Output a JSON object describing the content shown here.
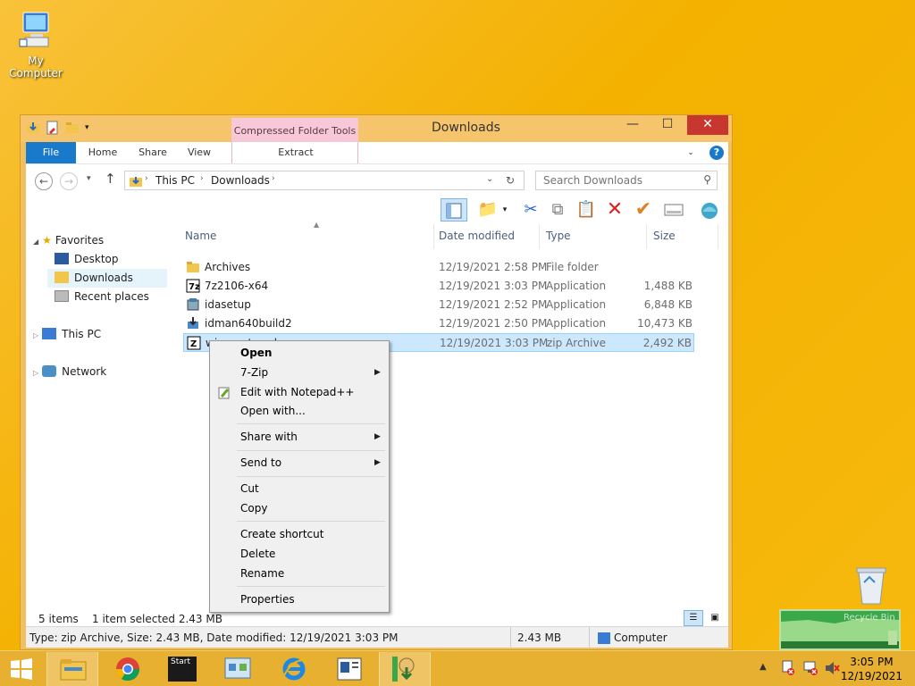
{
  "desktop": {
    "icons": [
      {
        "label": "My Computer"
      }
    ]
  },
  "window": {
    "title": "Downloads",
    "contextual_tab_group": "Compressed Folder Tools",
    "controls": {
      "minimize": "—",
      "maximize": "☐",
      "close": "✕"
    }
  },
  "ribbon": {
    "tabs": [
      "File",
      "Home",
      "Share",
      "View",
      "Extract"
    ],
    "help": "?"
  },
  "address": {
    "path": [
      "This PC",
      "Downloads"
    ],
    "search_placeholder": "Search Downloads"
  },
  "nav_pane": {
    "favorites": "Favorites",
    "desktop": "Desktop",
    "downloads": "Downloads",
    "recent": "Recent places",
    "this_pc": "This PC",
    "network": "Network"
  },
  "columns": {
    "name": "Name",
    "date": "Date modified",
    "type": "Type",
    "size": "Size"
  },
  "files": [
    {
      "name": "Archives",
      "date": "12/19/2021 2:58 PM",
      "type": "File folder",
      "size": ""
    },
    {
      "name": "7z2106-x64",
      "date": "12/19/2021 3:03 PM",
      "type": "Application",
      "size": "1,488 KB"
    },
    {
      "name": "idasetup",
      "date": "12/19/2021 2:52 PM",
      "type": "Application",
      "size": "6,848 KB"
    },
    {
      "name": "idman640build2",
      "date": "12/19/2021 2:50 PM",
      "type": "Application",
      "size": "10,473 KB"
    },
    {
      "name": "winaerotweaker",
      "date": "12/19/2021 3:03 PM",
      "type": "zip Archive",
      "size": "2,492 KB"
    }
  ],
  "status": {
    "items": "5 items",
    "selected": "1 item selected  2.43 MB",
    "details": "Type: zip Archive, Size: 2.43 MB, Date modified: 12/19/2021 3:03 PM",
    "size": "2.43 MB",
    "location": "Computer"
  },
  "context_menu": {
    "open": "Open",
    "seven_zip": "7-Zip",
    "edit_notepad": "Edit with Notepad++",
    "open_with": "Open with...",
    "share_with": "Share with",
    "send_to": "Send to",
    "cut": "Cut",
    "copy": "Copy",
    "create_shortcut": "Create shortcut",
    "delete": "Delete",
    "rename": "Rename",
    "properties": "Properties"
  },
  "recycle_bin": {
    "label": "Recycle Bin"
  },
  "taskbar": {
    "start_label": "Start",
    "time": "3:05 PM",
    "date": "12/19/2021"
  },
  "colors": {
    "accent": "#1979ca",
    "desktop": "#f4b100",
    "selection": "#cce8ff",
    "close": "#c7372f"
  }
}
